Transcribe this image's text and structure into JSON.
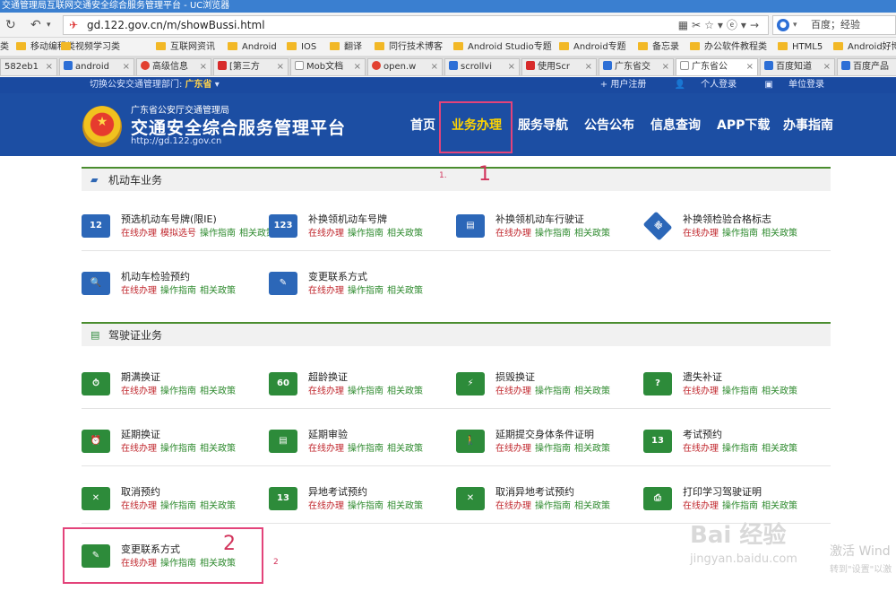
{
  "browser": {
    "window_title": "交通管理局互联网交通安全综合服务管理平台 - UC浏览器",
    "url": "gd.122.gov.cn/m/showBussi.html",
    "search_engine": "百度",
    "search_placeholder": "百度；经验",
    "bookmarks": [
      "类",
      "移动编程类",
      "视频学习类",
      "互联网资讯",
      "Android",
      "IOS",
      "翻译",
      "同行技术博客",
      "Android Studio专题",
      "Android专题",
      "备忘录",
      "办公软件教程类",
      "HTML5",
      "Android好博"
    ],
    "tabs": [
      "582eb1",
      "android",
      "高级信息",
      "[第三方",
      "Mob文档",
      "open.w",
      "scrollvi",
      "使用Scr",
      "广东省交",
      "广东省公",
      "百度知道",
      "百度产品"
    ]
  },
  "site": {
    "dept_label": "切换公安交通管理部门:",
    "dept_value": "广东省",
    "top_links": [
      "+ 用户注册",
      "个人登录",
      "单位登录"
    ],
    "org": "广东省公安厅交通管理局",
    "title": "交通安全综合服务管理平台",
    "url": "http://gd.122.gov.cn",
    "nav": [
      "首页",
      "业务办理",
      "服务导航",
      "公告公布",
      "信息查询",
      "APP下载",
      "办事指南"
    ],
    "nav_active": "业务办理"
  },
  "links": {
    "online": "在线办理",
    "guide": "操作指南",
    "policy": "相关政策",
    "extra": "模拟选号"
  },
  "sections": [
    {
      "title": "机动车业务",
      "services": [
        "预选机动车号牌(限IE)",
        "补换领机动车号牌",
        "补换领机动车行驶证",
        "补换领检验合格标志",
        "机动车检验预约",
        "变更联系方式"
      ]
    },
    {
      "title": "驾驶证业务",
      "services": [
        "期满换证",
        "超龄换证",
        "损毁换证",
        "遗失补证",
        "延期换证",
        "延期审验",
        "延期提交身体条件证明",
        "考试预约",
        "取消预约",
        "异地考试预约",
        "取消异地考试预约",
        "打印学习驾驶证明",
        "变更联系方式"
      ]
    }
  ],
  "annotations": {
    "step1_small": "1.",
    "step1": "1",
    "step2": "2",
    "step2_small": "2"
  },
  "watermark": {
    "brand": "Bai 经验",
    "url": "jingyan.baidu.com",
    "activate": "激活 Wind",
    "activate_sub": "转到\"设置\"以激"
  },
  "colors": {
    "header_blue": "#1c4ea3",
    "nav_active": "#ffd400",
    "online_red": "#c0262c",
    "guide_green": "#2e8a2e",
    "annotation_pink": "#e3437a"
  }
}
